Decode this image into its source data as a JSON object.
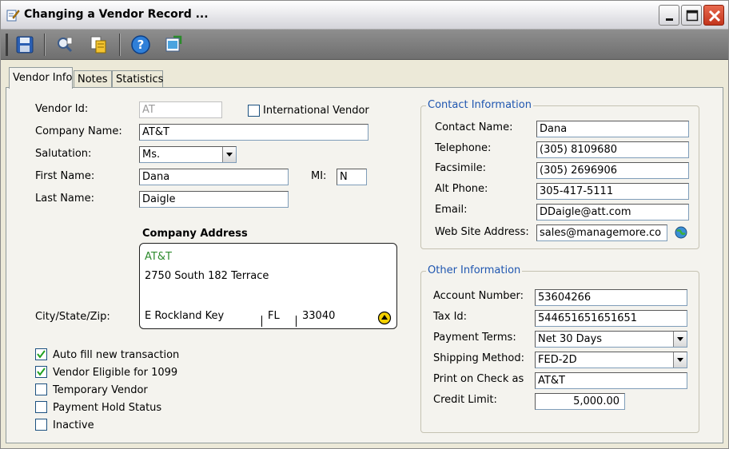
{
  "window": {
    "title": "Changing a Vendor Record ..."
  },
  "toolbar": {
    "buttons": [
      {
        "name": "save-icon"
      },
      {
        "name": "find-icon"
      },
      {
        "name": "copy-icon"
      },
      {
        "name": "help-icon"
      },
      {
        "name": "export-icon"
      }
    ]
  },
  "tabs": [
    {
      "label": "Vendor Info",
      "active": true
    },
    {
      "label": "Notes",
      "active": false
    },
    {
      "label": "Statistics",
      "active": false
    }
  ],
  "vendor": {
    "vendor_id_label": "Vendor Id:",
    "vendor_id": "AT",
    "international_label": "International Vendor",
    "international_checked": false,
    "company_name_label": "Company Name:",
    "company_name": "AT&T",
    "salutation_label": "Salutation:",
    "salutation": "Ms.",
    "first_name_label": "First Name:",
    "first_name": "Dana",
    "mi_label": "MI:",
    "mi": "N",
    "last_name_label": "Last Name:",
    "last_name": "Daigle"
  },
  "address": {
    "heading": "Company Address",
    "line1": "AT&T",
    "line2": "2750 South 182 Terrace",
    "city_state_zip_label": "City/State/Zip:",
    "city": "E Rockland Key",
    "state": "FL",
    "zip": "33040",
    "accent_color": "#2e8b2e"
  },
  "options": [
    {
      "label": "Auto fill new transaction",
      "checked": true
    },
    {
      "label": "Vendor Eligible for 1099",
      "checked": true
    },
    {
      "label": "Temporary Vendor",
      "checked": false
    },
    {
      "label": "Payment Hold Status",
      "checked": false
    },
    {
      "label": "Inactive",
      "checked": false
    }
  ],
  "contact": {
    "title": "Contact Information",
    "contact_name_label": "Contact Name:",
    "contact_name": "Dana",
    "telephone_label": "Telephone:",
    "telephone": "(305) 8109680",
    "facsimile_label": "Facsimile:",
    "facsimile": "(305) 2696906",
    "alt_phone_label": "Alt Phone:",
    "alt_phone": "305-417-5111",
    "email_label": "Email:",
    "email": "DDaigle@att.com",
    "website_label": "Web Site Address:",
    "website": "sales@managemore.co"
  },
  "other": {
    "title": "Other Information",
    "account_number_label": "Account Number:",
    "account_number": "53604266",
    "tax_id_label": "Tax Id:",
    "tax_id": "544651651651651",
    "payment_terms_label": "Payment Terms:",
    "payment_terms": "Net 30 Days",
    "shipping_method_label": "Shipping Method:",
    "shipping_method": "FED-2D",
    "print_on_check_label": "Print on Check as",
    "print_on_check": "AT&T",
    "credit_limit_label": "Credit Limit:",
    "credit_limit": "5,000.00"
  },
  "colors": {
    "group_title": "#1f56b0",
    "toolbar_bg": "#7f7f7f",
    "panel_bg": "#f4f3ee"
  }
}
